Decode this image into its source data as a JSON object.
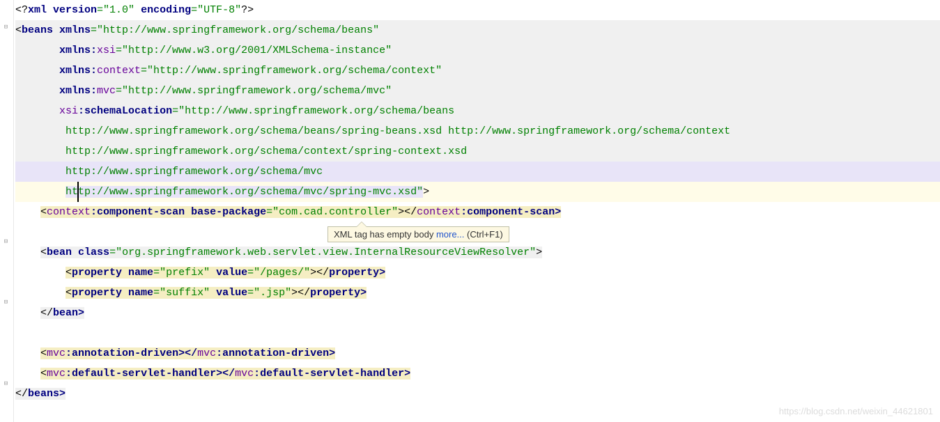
{
  "lines": {
    "l1_a": "<?",
    "l1_b": "xml version",
    "l1_c": "=\"1.0\" ",
    "l1_d": "encoding",
    "l1_e": "=\"UTF-8\"",
    "l1_f": "?>",
    "l2_a": "<",
    "l2_b": "beans ",
    "l2_c": "xmlns",
    "l2_d": "=\"http://www.springframework.org/schema/beans\"",
    "l3_a": "       ",
    "l3_b": "xmlns:",
    "l3_c": "xsi",
    "l3_d": "=\"http://www.w3.org/2001/XMLSchema-instance\"",
    "l4_a": "       ",
    "l4_b": "xmlns:",
    "l4_c": "context",
    "l4_d": "=\"http://www.springframework.org/schema/context\"",
    "l5_a": "       ",
    "l5_b": "xmlns:",
    "l5_c": "mvc",
    "l5_d": "=\"http://www.springframework.org/schema/mvc\"",
    "l6_a": "       ",
    "l6_b": "xsi",
    "l6_c": ":",
    "l6_d": "schemaLocation",
    "l6_e": "=\"http://www.springframework.org/schema/beans",
    "l7": "        http://www.springframework.org/schema/beans/spring-beans.xsd http://www.springframework.org/schema/context",
    "l8": "        http://www.springframework.org/schema/context/spring-context.xsd",
    "l9": "        http://www.springframework.org/schema/mvc",
    "l10_a": "        ",
    "l10_b": "http://www.springframework.org/schema/mvc/spring-mvc.xsd\"",
    "l10_c": ">",
    "l11_a": "    ",
    "l11_b": "<",
    "l11_c": "context",
    "l11_d": ":component-scan ",
    "l11_e": "base-package",
    "l11_f": "=\"com.cad.controller\"",
    "l11_g": "></",
    "l11_h": "context",
    "l11_i": ":component-scan>",
    "l12": "",
    "l13_a": "    ",
    "l13_b": "<",
    "l13_c": "bean ",
    "l13_d": "class",
    "l13_e": "=\"org.springframework.web.servlet.view.InternalResourceViewResolver\"",
    "l13_f": ">",
    "l14_a": "        ",
    "l14_b": "<",
    "l14_c": "property ",
    "l14_d": "name",
    "l14_e": "=\"prefix\" ",
    "l14_f": "value",
    "l14_g": "=\"/pages/\"",
    "l14_h": "></",
    "l14_i": "property>",
    "l15_a": "        ",
    "l15_b": "<",
    "l15_c": "property ",
    "l15_d": "name",
    "l15_e": "=\"suffix\" ",
    "l15_f": "value",
    "l15_g": "=\".jsp\"",
    "l15_h": "></",
    "l15_i": "property>",
    "l16_a": "    ",
    "l16_b": "</",
    "l16_c": "bean>",
    "l17": "",
    "l18_a": "    ",
    "l18_b": "<",
    "l18_c": "mvc",
    "l18_d": ":annotation-driven></",
    "l18_e": "mvc",
    "l18_f": ":annotation-driven>",
    "l19_a": "    ",
    "l19_b": "<",
    "l19_c": "mvc",
    "l19_d": ":default-servlet-handler></",
    "l19_e": "mvc",
    "l19_f": ":default-servlet-handler>",
    "l20_a": "</",
    "l20_b": "beans>"
  },
  "tooltip": {
    "text": "XML tag has empty body ",
    "link": "more...",
    "shortcut": " (Ctrl+F1)"
  },
  "watermark": "https://blog.csdn.net/weixin_44621801"
}
